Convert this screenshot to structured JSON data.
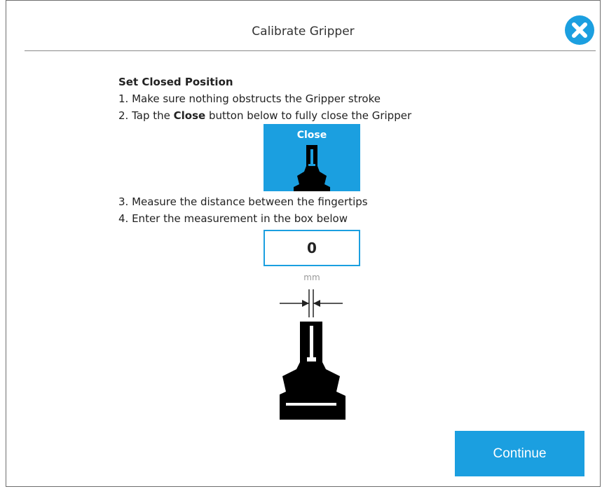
{
  "dialog": {
    "title": "Calibrate Gripper",
    "close_icon": "close-icon"
  },
  "instructions": {
    "heading": "Set Closed Position",
    "step1": "1. Make sure nothing obstructs the Gripper stroke",
    "step2_prefix": "2. Tap the ",
    "step2_bold": "Close",
    "step2_suffix": " button below to fully close the Gripper",
    "close_button_label": "Close",
    "step3": "3. Measure the distance between the fingertips",
    "step4": "4. Enter the measurement in the box below"
  },
  "measurement": {
    "value": "0",
    "unit": "mm"
  },
  "footer": {
    "continue_label": "Continue"
  },
  "colors": {
    "accent": "#1b9fe0",
    "text": "#222222",
    "muted": "#999999"
  }
}
